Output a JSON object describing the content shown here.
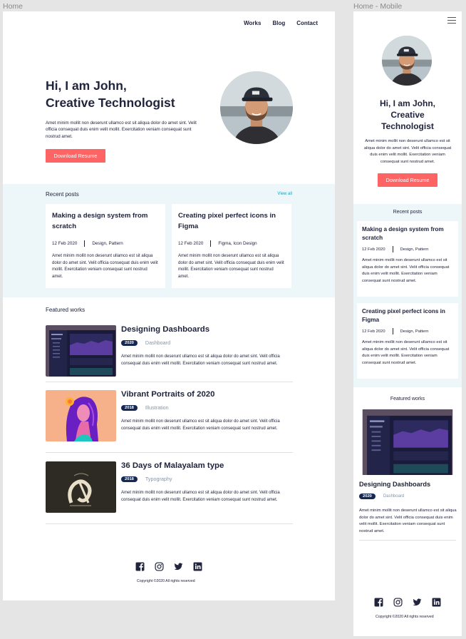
{
  "frames": {
    "desktop": "Home",
    "mobile": "Home - Mobile"
  },
  "nav": [
    "Works",
    "Blog",
    "Contact"
  ],
  "hero": {
    "line1": "Hi, I am John,",
    "line2": "Creative Technologist",
    "mobile_lines": [
      "Hi, I am John,",
      "Creative",
      "Technologist"
    ],
    "text": "Amet minim mollit non deserunt ullamco est sit aliqua dolor do amet sint. Velit officia consequat duis enim velit mollit. Exercitation veniam consequat sunt nostrud amet.",
    "button": "Download Resume"
  },
  "recent": {
    "heading": "Recent posts",
    "view_all": "View all",
    "posts": [
      {
        "title": "Making a design system from scratch",
        "date": "12 Feb 2020",
        "tags": "Design, Pattern",
        "text": "Amet minim mollit non deserunt ullamco est sit aliqua dolor do amet sint. Velit officia consequat duis enim velit mollit. Exercitation veniam consequat sunt nostrud amet."
      },
      {
        "title": "Creating pixel perfect icons in Figma",
        "date": "12 Feb 2020",
        "tags": "Figma, Icon Design",
        "text": "Amet minim mollit non deserunt ullamco est sit aliqua dolor do amet sint. Velit officia consequat duis enim velit mollit. Exercitation veniam consequat sunt nostrud amet."
      }
    ],
    "mobile_posts": [
      {
        "title": "Making a design system from scratch",
        "date": "12 Feb 2020",
        "tags": "Design, Pattern",
        "text": "Amet minim mollit non deserunt ullamco est sit aliqua dolor do amet sint. Velit officia consequat duis enim velit mollit. Exercitation veniam consequat sunt nostrud amet."
      },
      {
        "title": "Creating pixel perfect icons in Figma",
        "date": "12 Feb 2020",
        "tags": "Design, Pattern",
        "text": "Amet minim mollit non deserunt ullamco est sit aliqua dolor do amet sint. Velit officia consequat duis enim velit mollit. Exercitation veniam consequat sunt nostrud amet."
      }
    ]
  },
  "featured": {
    "heading": "Featured works",
    "works": [
      {
        "title": "Designing Dashboards",
        "year": "2020",
        "category": "Dashboard",
        "text": "Amet minim mollit non deserunt ullamco est sit aliqua dolor do amet sint. Velit officia consequat duis enim velit mollit. Exercitation veniam consequat sunt nostrud amet."
      },
      {
        "title": "Vibrant Portraits of 2020",
        "year": "2018",
        "category": "Illustration",
        "text": "Amet minim mollit non deserunt ullamco est sit aliqua dolor do amet sint. Velit officia consequat duis enim velit mollit. Exercitation veniam consequat sunt nostrud amet."
      },
      {
        "title": "36 Days of Malayalam type",
        "year": "2018",
        "category": "Typography",
        "text": "Amet minim mollit non deserunt ullamco est sit aliqua dolor do amet sint. Velit officia consequat duis enim velit mollit. Exercitation veniam consequat sunt nostrud amet."
      }
    ]
  },
  "footer": {
    "copyright": "Copyright ©2020 All rights reserved",
    "icons": [
      "facebook-icon",
      "instagram-icon",
      "twitter-icon",
      "linkedin-icon"
    ]
  },
  "colors": {
    "accent": "#ff6464",
    "navy": "#142850",
    "tint": "#edf7fa",
    "link": "#00a8cc",
    "text": "#21243d"
  }
}
